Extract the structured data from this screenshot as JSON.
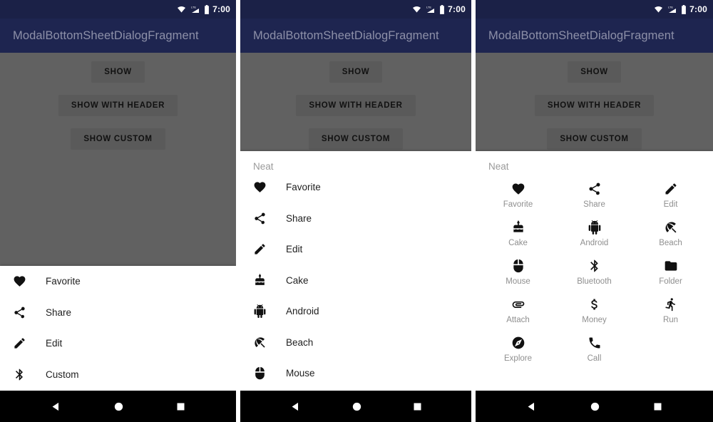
{
  "statusbar": {
    "time": "7:00",
    "icons": [
      "wifi-icon",
      "lte-signal-icon",
      "battery-icon"
    ]
  },
  "appbar": {
    "title": "ModalBottomSheetDialogFragment"
  },
  "buttons": {
    "show": "SHOW",
    "show_with_header": "SHOW WITH HEADER",
    "show_custom": "SHOW CUSTOM"
  },
  "navbar": {
    "back": "back-icon",
    "home": "home-icon",
    "recents": "recents-icon"
  },
  "panel1": {
    "sheet": {
      "items": [
        {
          "icon": "heart-icon",
          "label": "Favorite"
        },
        {
          "icon": "share-icon",
          "label": "Share"
        },
        {
          "icon": "pencil-icon",
          "label": "Edit"
        },
        {
          "icon": "bluetooth-icon",
          "label": "Custom"
        }
      ]
    }
  },
  "panel2": {
    "sheet": {
      "header": "Neat",
      "items": [
        {
          "icon": "heart-icon",
          "label": "Favorite"
        },
        {
          "icon": "share-icon",
          "label": "Share"
        },
        {
          "icon": "pencil-icon",
          "label": "Edit"
        },
        {
          "icon": "cake-icon",
          "label": "Cake"
        },
        {
          "icon": "android-icon",
          "label": "Android"
        },
        {
          "icon": "beach-umbrella-icon",
          "label": "Beach"
        },
        {
          "icon": "mouse-icon",
          "label": "Mouse"
        }
      ]
    }
  },
  "panel3": {
    "sheet": {
      "header": "Neat",
      "items": [
        {
          "icon": "heart-icon",
          "label": "Favorite"
        },
        {
          "icon": "share-icon",
          "label": "Share"
        },
        {
          "icon": "pencil-icon",
          "label": "Edit"
        },
        {
          "icon": "cake-icon",
          "label": "Cake"
        },
        {
          "icon": "android-icon",
          "label": "Android"
        },
        {
          "icon": "beach-umbrella-icon",
          "label": "Beach"
        },
        {
          "icon": "mouse-icon",
          "label": "Mouse"
        },
        {
          "icon": "bluetooth-icon",
          "label": "Bluetooth"
        },
        {
          "icon": "folder-icon",
          "label": "Folder"
        },
        {
          "icon": "attach-icon",
          "label": "Attach"
        },
        {
          "icon": "money-icon",
          "label": "Money"
        },
        {
          "icon": "run-icon",
          "label": "Run"
        },
        {
          "icon": "explore-icon",
          "label": "Explore"
        },
        {
          "icon": "call-icon",
          "label": "Call"
        }
      ]
    }
  },
  "colors": {
    "appbar": "#1e2550",
    "statusbar": "#1b2147",
    "scrim": "#616161",
    "sheet": "#ffffff",
    "navbar": "#000000",
    "header_text": "#9a9a9a",
    "grid_label": "#8f8f8f"
  }
}
